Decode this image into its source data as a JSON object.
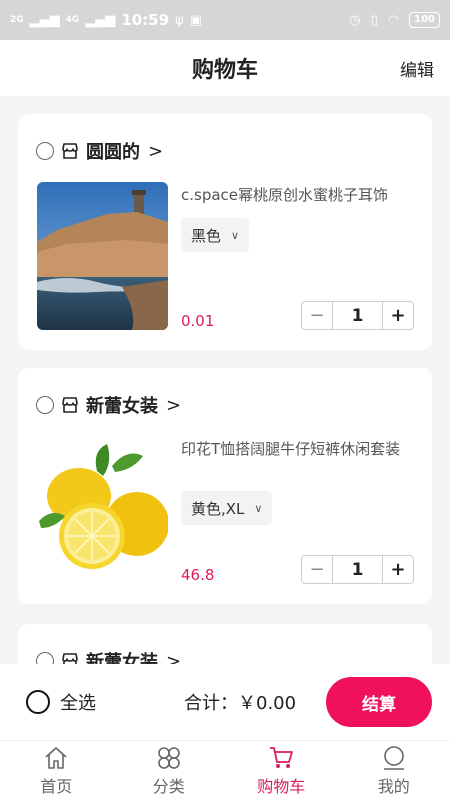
{
  "status_bar": {
    "signal1": "2G",
    "signal2": "4G",
    "time": "10:59",
    "battery": "100"
  },
  "header": {
    "title": "购物车",
    "edit_label": "编辑"
  },
  "shops": [
    {
      "name": "圆圆的",
      "product": {
        "name": "c.space幂桃原创水蜜桃子耳饰",
        "spec": "黑色",
        "price": "0.01",
        "qty": "1",
        "image": "coastal-lighthouse-photo"
      }
    },
    {
      "name": "新蕾女装",
      "product": {
        "name": "印花T恤搭阔腿牛仔短裤休闲套装",
        "spec": "黄色,XL",
        "price": "46.8",
        "qty": "1",
        "image": "lemons-photo"
      }
    },
    {
      "name": "新蕾女装"
    }
  ],
  "stepper": {
    "minus": "−",
    "plus": "+"
  },
  "checkout": {
    "select_all": "全选",
    "total": "合计：￥0.00",
    "pay_button": "结算"
  },
  "tabbar": {
    "items": [
      {
        "label": "首页",
        "icon": "home-icon"
      },
      {
        "label": "分类",
        "icon": "category-icon"
      },
      {
        "label": "购物车",
        "icon": "cart-icon",
        "active": true
      },
      {
        "label": "我的",
        "icon": "user-icon"
      }
    ]
  },
  "colors": {
    "accent": "#f0115d",
    "price": "#d81e5b",
    "status_bar": "#d6d6d6"
  }
}
